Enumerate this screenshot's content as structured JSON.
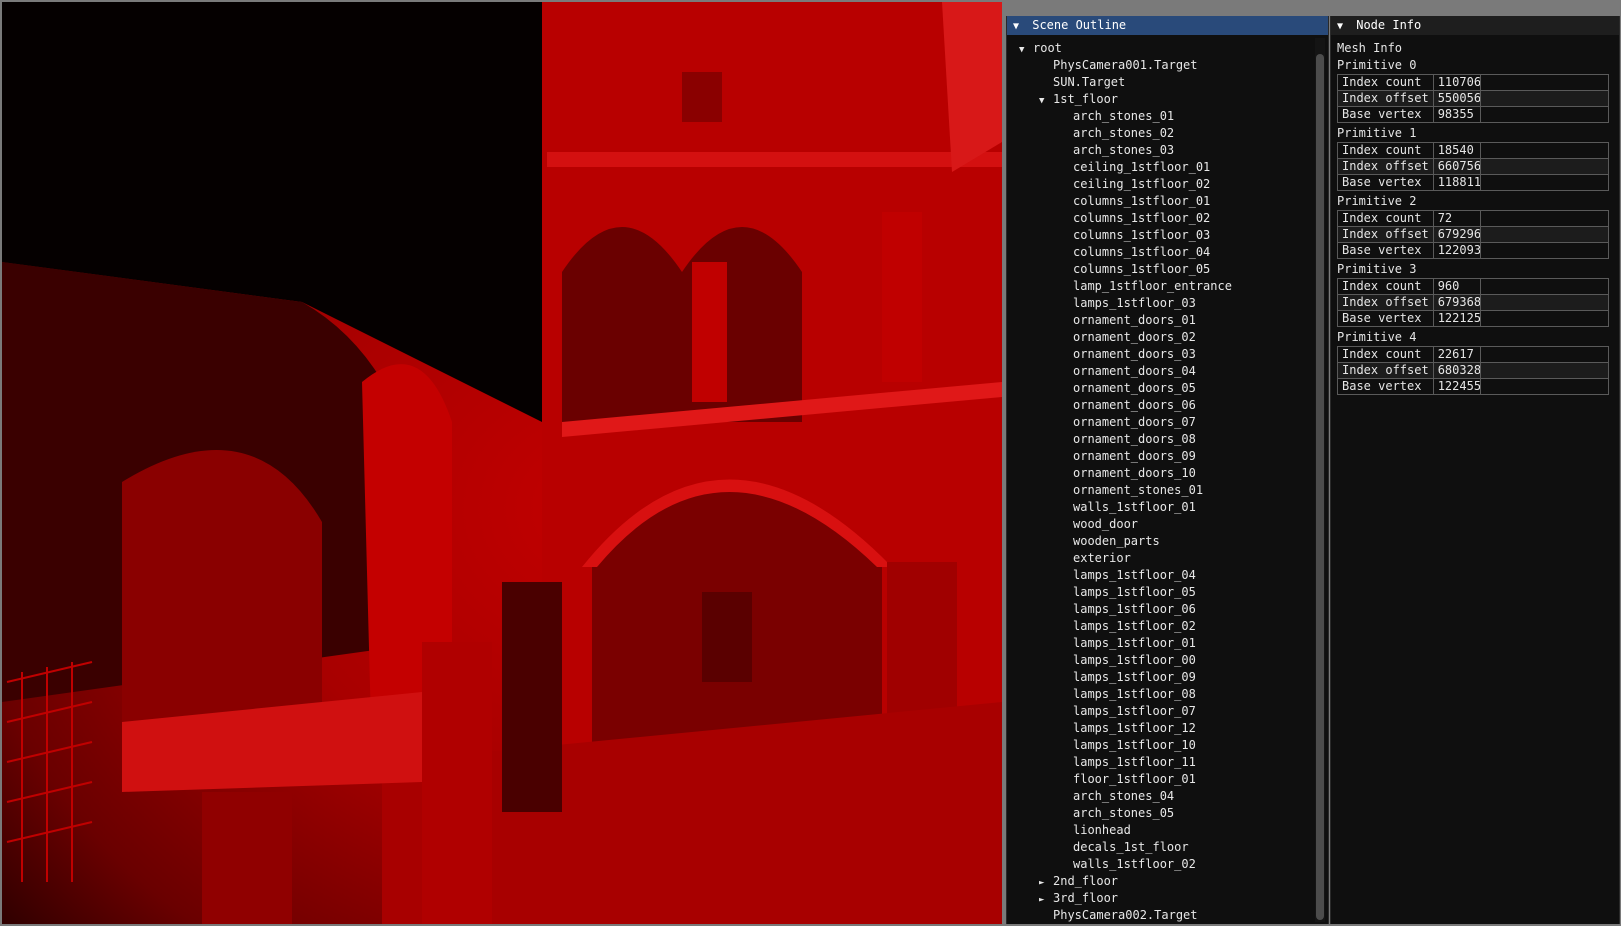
{
  "viewport": {
    "palette": {
      "shade": "#c40000",
      "dark": "#000000",
      "highlight": "#e02020"
    }
  },
  "scene_outline": {
    "title": "Scene Outline",
    "items": [
      {
        "label": "root",
        "depth": 0,
        "arrow": "▼"
      },
      {
        "label": "PhysCamera001.Target",
        "depth": 1,
        "arrow": ""
      },
      {
        "label": "SUN.Target",
        "depth": 1,
        "arrow": ""
      },
      {
        "label": "1st_floor",
        "depth": 1,
        "arrow": "▼"
      },
      {
        "label": "arch_stones_01",
        "depth": 2,
        "arrow": ""
      },
      {
        "label": "arch_stones_02",
        "depth": 2,
        "arrow": ""
      },
      {
        "label": "arch_stones_03",
        "depth": 2,
        "arrow": ""
      },
      {
        "label": "ceiling_1stfloor_01",
        "depth": 2,
        "arrow": ""
      },
      {
        "label": "ceiling_1stfloor_02",
        "depth": 2,
        "arrow": ""
      },
      {
        "label": "columns_1stfloor_01",
        "depth": 2,
        "arrow": ""
      },
      {
        "label": "columns_1stfloor_02",
        "depth": 2,
        "arrow": ""
      },
      {
        "label": "columns_1stfloor_03",
        "depth": 2,
        "arrow": ""
      },
      {
        "label": "columns_1stfloor_04",
        "depth": 2,
        "arrow": ""
      },
      {
        "label": "columns_1stfloor_05",
        "depth": 2,
        "arrow": ""
      },
      {
        "label": "lamp_1stfloor_entrance",
        "depth": 2,
        "arrow": ""
      },
      {
        "label": "lamps_1stfloor_03",
        "depth": 2,
        "arrow": ""
      },
      {
        "label": "ornament_doors_01",
        "depth": 2,
        "arrow": ""
      },
      {
        "label": "ornament_doors_02",
        "depth": 2,
        "arrow": ""
      },
      {
        "label": "ornament_doors_03",
        "depth": 2,
        "arrow": ""
      },
      {
        "label": "ornament_doors_04",
        "depth": 2,
        "arrow": ""
      },
      {
        "label": "ornament_doors_05",
        "depth": 2,
        "arrow": ""
      },
      {
        "label": "ornament_doors_06",
        "depth": 2,
        "arrow": ""
      },
      {
        "label": "ornament_doors_07",
        "depth": 2,
        "arrow": ""
      },
      {
        "label": "ornament_doors_08",
        "depth": 2,
        "arrow": ""
      },
      {
        "label": "ornament_doors_09",
        "depth": 2,
        "arrow": ""
      },
      {
        "label": "ornament_doors_10",
        "depth": 2,
        "arrow": ""
      },
      {
        "label": "ornament_stones_01",
        "depth": 2,
        "arrow": ""
      },
      {
        "label": "walls_1stfloor_01",
        "depth": 2,
        "arrow": ""
      },
      {
        "label": "wood_door",
        "depth": 2,
        "arrow": ""
      },
      {
        "label": "wooden_parts",
        "depth": 2,
        "arrow": ""
      },
      {
        "label": "exterior",
        "depth": 2,
        "arrow": ""
      },
      {
        "label": "lamps_1stfloor_04",
        "depth": 2,
        "arrow": ""
      },
      {
        "label": "lamps_1stfloor_05",
        "depth": 2,
        "arrow": ""
      },
      {
        "label": "lamps_1stfloor_06",
        "depth": 2,
        "arrow": ""
      },
      {
        "label": "lamps_1stfloor_02",
        "depth": 2,
        "arrow": ""
      },
      {
        "label": "lamps_1stfloor_01",
        "depth": 2,
        "arrow": ""
      },
      {
        "label": "lamps_1stfloor_00",
        "depth": 2,
        "arrow": ""
      },
      {
        "label": "lamps_1stfloor_09",
        "depth": 2,
        "arrow": ""
      },
      {
        "label": "lamps_1stfloor_08",
        "depth": 2,
        "arrow": ""
      },
      {
        "label": "lamps_1stfloor_07",
        "depth": 2,
        "arrow": ""
      },
      {
        "label": "lamps_1stfloor_12",
        "depth": 2,
        "arrow": ""
      },
      {
        "label": "lamps_1stfloor_10",
        "depth": 2,
        "arrow": ""
      },
      {
        "label": "lamps_1stfloor_11",
        "depth": 2,
        "arrow": ""
      },
      {
        "label": "floor_1stfloor_01",
        "depth": 2,
        "arrow": ""
      },
      {
        "label": "arch_stones_04",
        "depth": 2,
        "arrow": ""
      },
      {
        "label": "arch_stones_05",
        "depth": 2,
        "arrow": ""
      },
      {
        "label": "lionhead",
        "depth": 2,
        "arrow": ""
      },
      {
        "label": "decals_1st_floor",
        "depth": 2,
        "arrow": ""
      },
      {
        "label": "walls_1stfloor_02",
        "depth": 2,
        "arrow": ""
      },
      {
        "label": "2nd_floor",
        "depth": 1,
        "arrow": "►"
      },
      {
        "label": "3rd_floor",
        "depth": 1,
        "arrow": "►"
      },
      {
        "label": "PhysCamera002.Target",
        "depth": 1,
        "arrow": ""
      }
    ]
  },
  "node_info": {
    "title": "Node Info",
    "mesh_label": "Mesh Info",
    "primitives": [
      {
        "name": "Primitive 0",
        "rows": [
          {
            "key": "Index count",
            "value": "110706"
          },
          {
            "key": "Index offset",
            "value": "550056"
          },
          {
            "key": "Base vertex",
            "value": "98355"
          }
        ]
      },
      {
        "name": "Primitive 1",
        "rows": [
          {
            "key": "Index count",
            "value": "18540"
          },
          {
            "key": "Index offset",
            "value": "660756"
          },
          {
            "key": "Base vertex",
            "value": "118811"
          }
        ]
      },
      {
        "name": "Primitive 2",
        "rows": [
          {
            "key": "Index count",
            "value": "72"
          },
          {
            "key": "Index offset",
            "value": "679296"
          },
          {
            "key": "Base vertex",
            "value": "122093"
          }
        ]
      },
      {
        "name": "Primitive 3",
        "rows": [
          {
            "key": "Index count",
            "value": "960"
          },
          {
            "key": "Index offset",
            "value": "679368"
          },
          {
            "key": "Base vertex",
            "value": "122125"
          }
        ]
      },
      {
        "name": "Primitive 4",
        "rows": [
          {
            "key": "Index count",
            "value": "22617"
          },
          {
            "key": "Index offset",
            "value": "680328"
          },
          {
            "key": "Base vertex",
            "value": "122455"
          }
        ]
      }
    ]
  }
}
